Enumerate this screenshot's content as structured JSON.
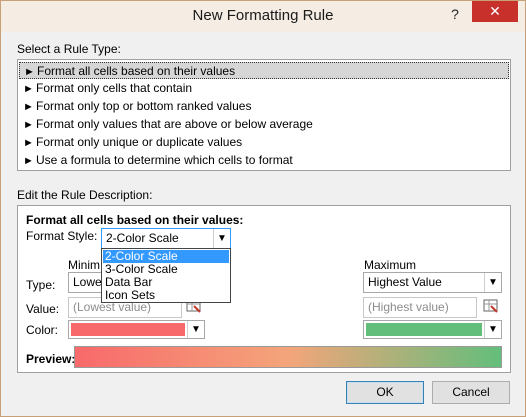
{
  "window": {
    "title": "New Formatting Rule"
  },
  "titlebar": {
    "help_glyph": "?",
    "close_glyph": "✕"
  },
  "rule_type": {
    "heading": "Select a Rule Type:",
    "arrow": "►",
    "items": [
      {
        "label": "Format all cells based on their values"
      },
      {
        "label": "Format only cells that contain"
      },
      {
        "label": "Format only top or bottom ranked values"
      },
      {
        "label": "Format only values that are above or below average"
      },
      {
        "label": "Format only unique or duplicate values"
      },
      {
        "label": "Use a formula to determine which cells to format"
      }
    ],
    "selected_index": 0
  },
  "description": {
    "heading": "Edit the Rule Description:",
    "subheading": "Format all cells based on their values:",
    "format_style": {
      "label": "Format Style:",
      "value": "2-Color Scale",
      "options": [
        "2-Color Scale",
        "3-Color Scale",
        "Data Bar",
        "Icon Sets"
      ],
      "highlighted_option": "2-Color Scale"
    },
    "minimum": {
      "heading": "Minim",
      "type_value": "Lowes",
      "value_placeholder": "(Lowest value)",
      "color": "#f8696b"
    },
    "maximum": {
      "heading": "Maximum",
      "type_value": "Highest Value",
      "value_placeholder": "(Highest value)",
      "color": "#63be7b"
    },
    "row_labels": {
      "type": "Type:",
      "value": "Value:",
      "color": "Color:"
    },
    "preview_label": "Preview:",
    "preview_gradient": {
      "from": "#f8696b",
      "mid": "#f4a57a",
      "to": "#63be7b"
    }
  },
  "buttons": {
    "ok": "OK",
    "cancel": "Cancel"
  },
  "icons": {
    "dropdown_arrow": "▼",
    "range_select": "range-select-icon"
  }
}
